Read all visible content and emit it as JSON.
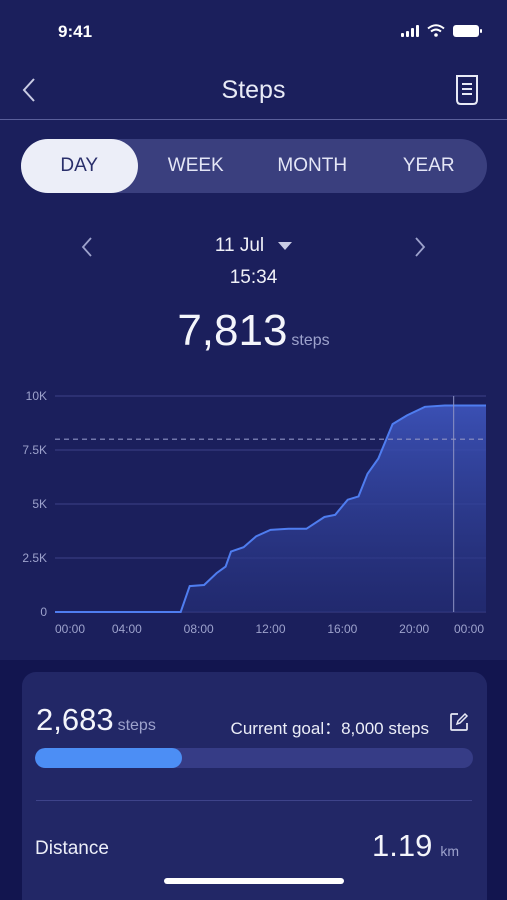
{
  "status_bar": {
    "time": "9:41"
  },
  "nav": {
    "title": "Steps"
  },
  "tabs": [
    {
      "label": "DAY",
      "active": true
    },
    {
      "label": "WEEK",
      "active": false
    },
    {
      "label": "MONTH",
      "active": false
    },
    {
      "label": "YEAR",
      "active": false
    }
  ],
  "date": {
    "label": "11 Jul",
    "time": "15:34"
  },
  "total": {
    "value": "7,813",
    "unit": "steps"
  },
  "chart_data": {
    "type": "area",
    "x_ticks": [
      "00:00",
      "04:00",
      "08:00",
      "12:00",
      "16:00",
      "20:00",
      "00:00"
    ],
    "y_ticks": [
      "0",
      "2.5K",
      "5K",
      "7.5K",
      "10K"
    ],
    "xlim": [
      0,
      24
    ],
    "ylim": [
      0,
      10000
    ],
    "goal_line": 8000,
    "cursor_hour": 22.2,
    "series": [
      {
        "x": [
          0,
          7.0,
          7.5,
          8.3,
          9.0,
          9.5,
          9.8,
          10.5,
          11.2,
          12.0,
          13.0,
          14.0,
          15.0,
          15.6,
          16.3,
          16.9,
          17.4,
          18.0,
          18.8,
          19.6,
          20.6,
          21.7,
          22.3,
          24.0
        ],
        "y": [
          0,
          0,
          1200,
          1250,
          1800,
          2100,
          2800,
          3000,
          3500,
          3800,
          3850,
          3850,
          4400,
          4500,
          5200,
          5350,
          6400,
          7100,
          8700,
          9100,
          9500,
          9560,
          9560,
          9560
        ]
      }
    ],
    "colors": {
      "line": "#4f7df0",
      "fill_top": "#3c52b8",
      "fill_bottom": "#25307a",
      "goal": "#8e93c4"
    }
  },
  "card": {
    "steps_value": "2,683",
    "steps_unit": "steps",
    "goal_text": "Current goal：8,000 steps",
    "progress_fraction": 0.3354,
    "distance_label": "Distance",
    "distance_value": "1.19",
    "distance_unit": "km"
  },
  "icons": [
    "chevron-left-icon",
    "document-icon",
    "chevron-right-icon",
    "caret-down-icon",
    "edit-icon"
  ]
}
